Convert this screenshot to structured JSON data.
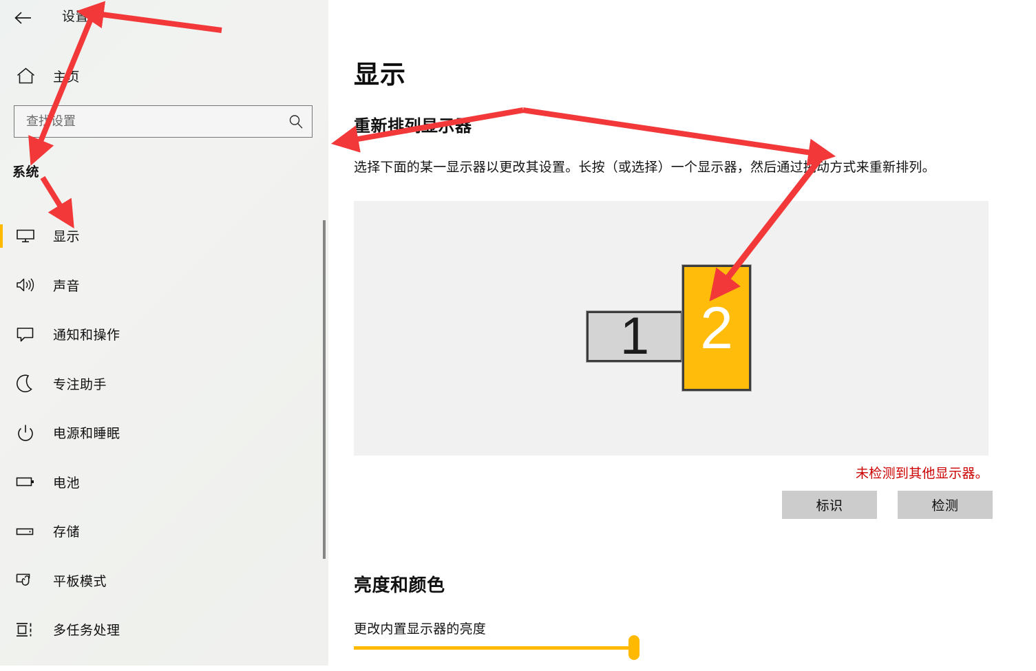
{
  "window": {
    "app_title": "设置",
    "back_icon": "back-arrow-icon"
  },
  "sidebar": {
    "home_label": "主页",
    "home_icon": "home-icon",
    "search": {
      "placeholder": "查找设置",
      "value": "",
      "icon": "search-icon"
    },
    "group_header": "系统",
    "items": [
      {
        "label": "显示",
        "icon": "monitor-icon",
        "selected": true
      },
      {
        "label": "声音",
        "icon": "speaker-icon",
        "selected": false
      },
      {
        "label": "通知和操作",
        "icon": "chat-bubble-icon",
        "selected": false
      },
      {
        "label": "专注助手",
        "icon": "moon-icon",
        "selected": false
      },
      {
        "label": "电源和睡眠",
        "icon": "power-icon",
        "selected": false
      },
      {
        "label": "电池",
        "icon": "battery-icon",
        "selected": false
      },
      {
        "label": "存储",
        "icon": "storage-icon",
        "selected": false
      },
      {
        "label": "平板模式",
        "icon": "tablet-mode-icon",
        "selected": false
      },
      {
        "label": "多任务处理",
        "icon": "multitasking-icon",
        "selected": false
      }
    ]
  },
  "main": {
    "page_title": "显示",
    "rearrange": {
      "title": "重新排列显示器",
      "description": "选择下面的某一显示器以更改其设置。长按（或选择）一个显示器，然后通过拖动方式来重新排列。",
      "monitors": [
        {
          "number": "1",
          "selected": false
        },
        {
          "number": "2",
          "selected": true
        }
      ],
      "detect_message": "未检测到其他显示器。",
      "identify_button": "标识",
      "detect_button": "检测"
    },
    "brightness": {
      "title": "亮度和颜色",
      "slider_label": "更改内置显示器的亮度",
      "slider_value": 97
    }
  },
  "colors": {
    "accent": "#ffb900",
    "selected_monitor": "#ffbc0b",
    "unselected_monitor": "#d4d4d4",
    "error_text": "#cc0000",
    "annotation_arrow": "#f23838",
    "button_face": "#cccccc"
  }
}
